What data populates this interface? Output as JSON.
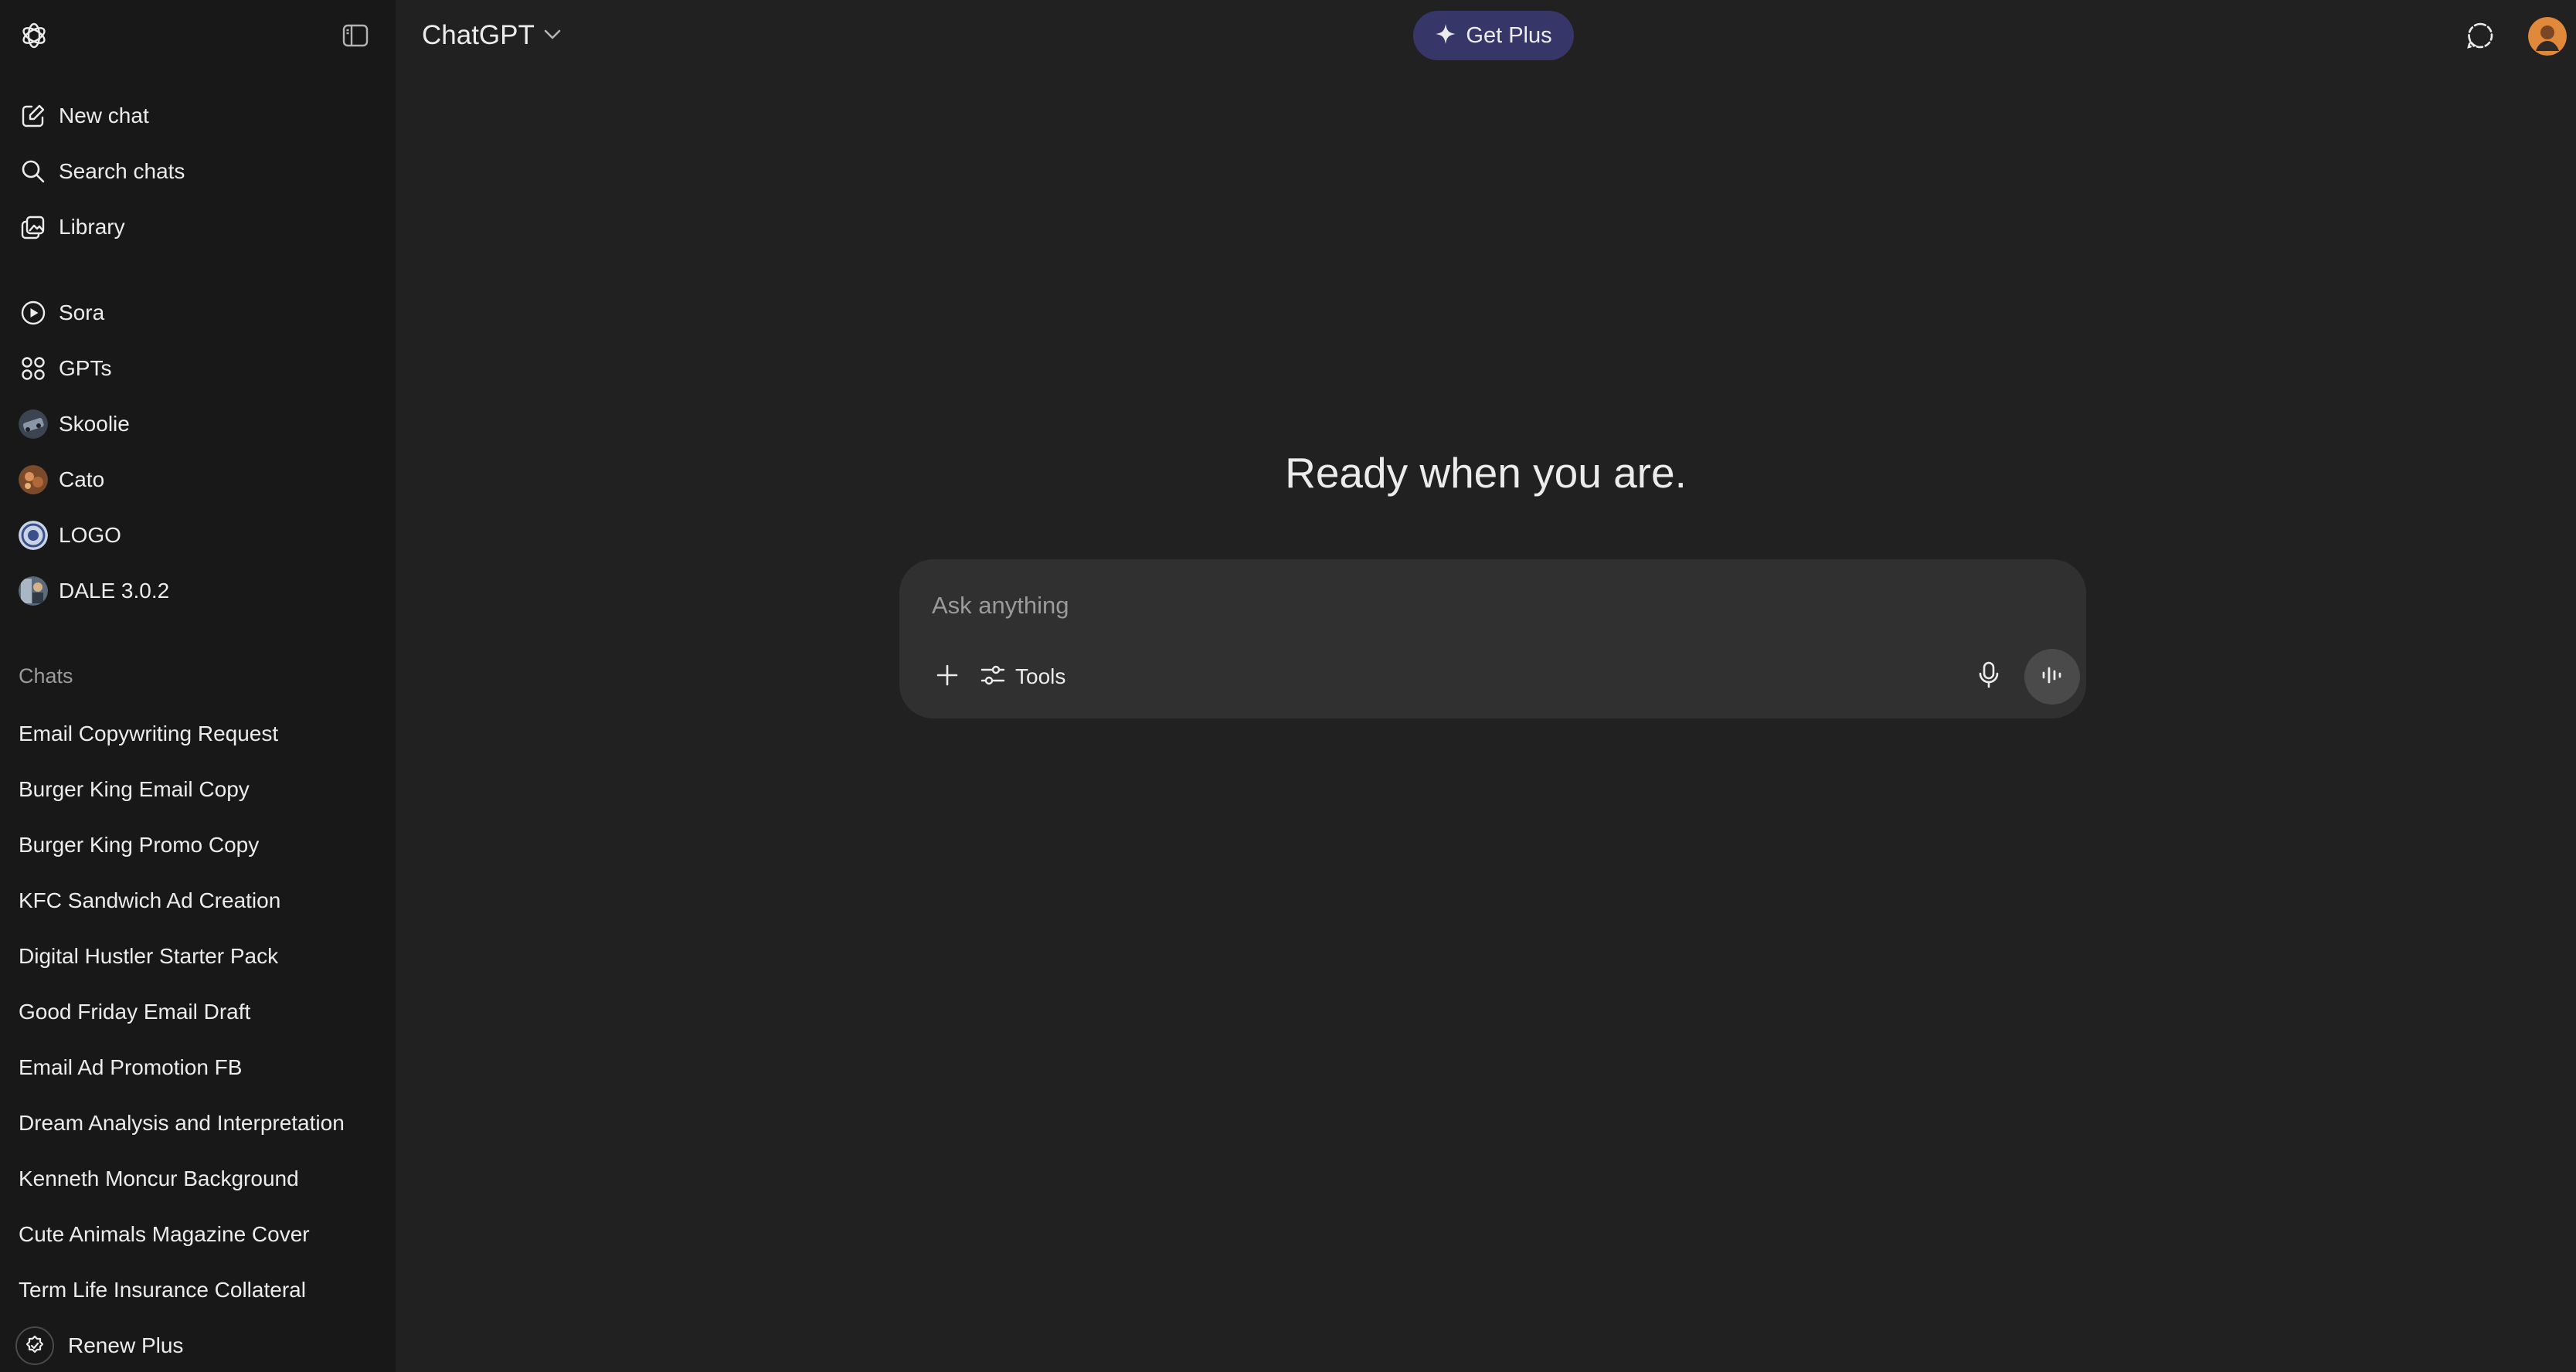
{
  "sidebar": {
    "nav": [
      {
        "label": "New chat",
        "icon": "edit-icon"
      },
      {
        "label": "Search chats",
        "icon": "search-icon"
      },
      {
        "label": "Library",
        "icon": "library-icon"
      }
    ],
    "apps": [
      {
        "label": "Sora",
        "icon": "play-circle-icon"
      },
      {
        "label": "GPTs",
        "icon": "grid-icon"
      },
      {
        "label": "Skoolie",
        "icon": "avatar-skoolie"
      },
      {
        "label": "Cato",
        "icon": "avatar-cato"
      },
      {
        "label": "LOGO",
        "icon": "avatar-logo"
      },
      {
        "label": "DALE 3.0.2",
        "icon": "avatar-dale"
      }
    ],
    "chats_title": "Chats",
    "chats": [
      "Email Copywriting Request",
      "Burger King Email Copy",
      "Burger King Promo Copy",
      "KFC Sandwich Ad Creation",
      "Digital Hustler Starter Pack",
      "Good Friday Email Draft",
      "Email Ad Promotion FB",
      "Dream Analysis and Interpretation",
      "Kenneth Moncur Background",
      "Cute Animals Magazine Cover",
      "Term Life Insurance Collateral"
    ],
    "renew_label": "Renew Plus"
  },
  "header": {
    "model": "ChatGPT",
    "get_plus": "Get Plus"
  },
  "main": {
    "headline": "Ready when you are.",
    "composer": {
      "placeholder": "Ask anything",
      "tools_label": "Tools"
    }
  },
  "colors": {
    "sidebar_bg": "#181818",
    "main_bg": "#212121",
    "composer_bg": "#303030",
    "get_plus_bg": "#373669",
    "text": "#ececec",
    "muted": "#9b9b9b"
  }
}
